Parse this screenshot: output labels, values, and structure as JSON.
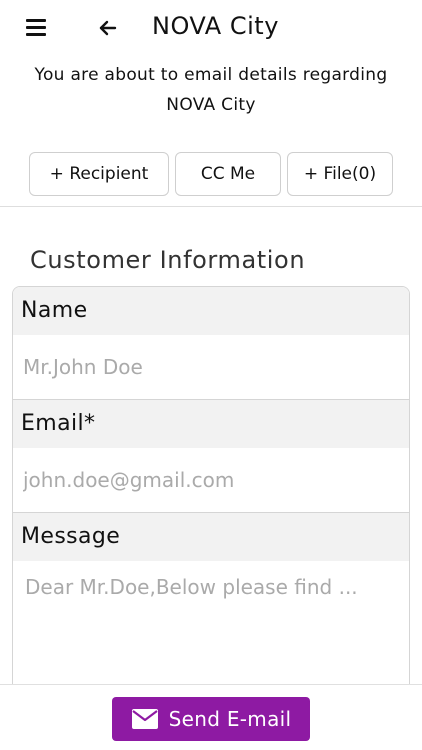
{
  "header": {
    "title": "NOVA City",
    "menu_icon": "hamburger-menu-icon",
    "back_icon": "arrow-left-icon"
  },
  "intro": {
    "line1": "You are about to email details regarding",
    "line2": "NOVA City"
  },
  "actions": {
    "recipient_label": "+ Recipient",
    "ccme_label": "CC Me",
    "file_label": "+ File(0)"
  },
  "section": {
    "title": "Customer Information"
  },
  "form": {
    "name_label": "Name",
    "name_placeholder": "Mr.John Doe",
    "email_label": "Email*",
    "email_placeholder": "john.doe@gmail.com",
    "message_label": "Message",
    "message_placeholder": "Dear Mr.Doe,Below please find ..."
  },
  "footer": {
    "send_label": "Send E-mail",
    "send_icon": "envelope-icon",
    "accent_color": "#8e1aa3"
  }
}
